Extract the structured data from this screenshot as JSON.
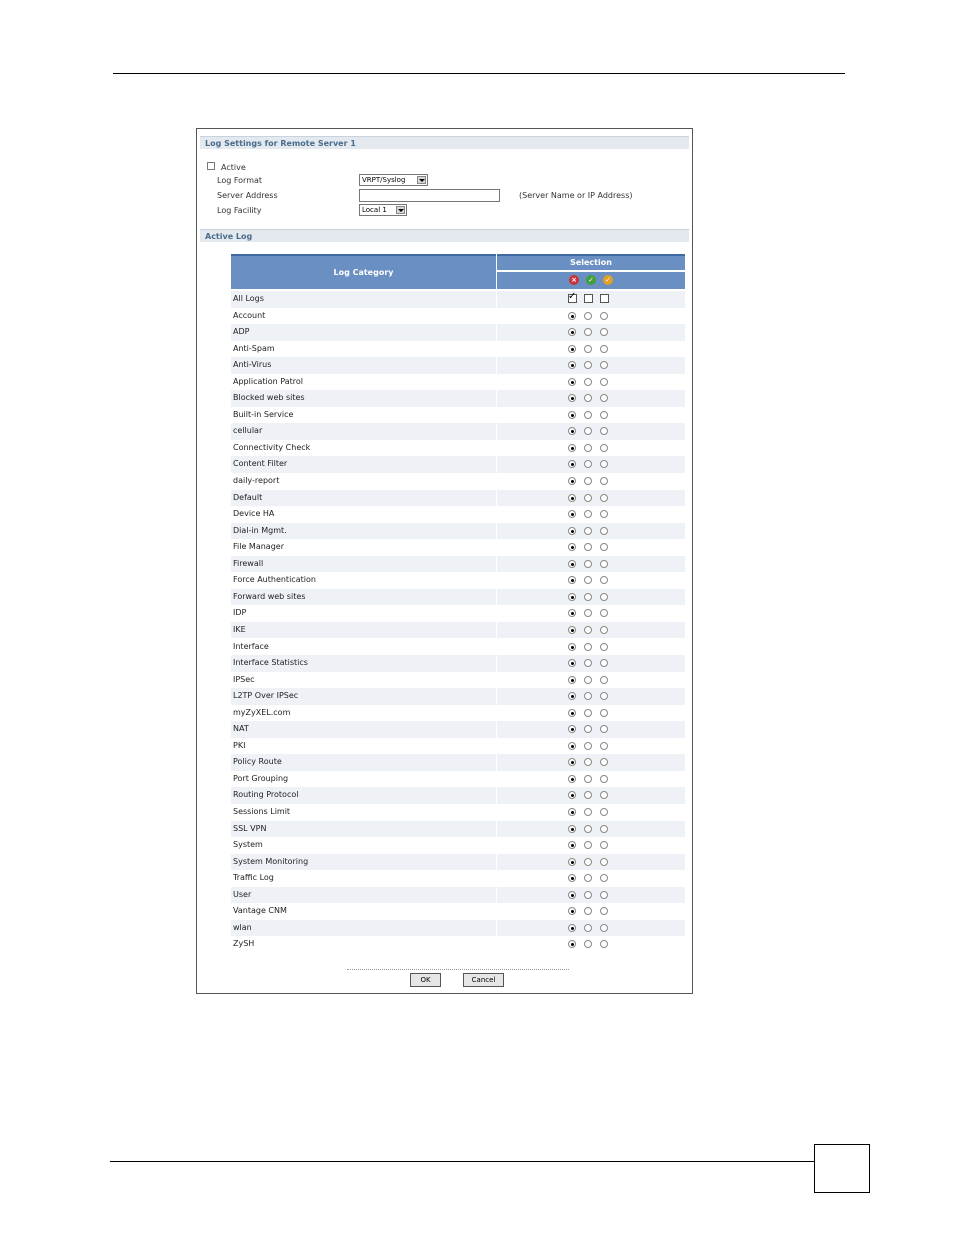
{
  "section1": {
    "title": "Log Settings for Remote Server 1",
    "active_label": "Active",
    "log_format_label": "Log Format",
    "log_format_value": "VRPT/Syslog",
    "server_address_label": "Server Address",
    "server_address_value": "",
    "server_hint": "(Server Name or IP Address)",
    "log_facility_label": "Log Facility",
    "log_facility_value": "Local 1"
  },
  "section2": {
    "title": "Active Log",
    "col_category": "Log Category",
    "col_selection": "Selection",
    "selection_icons": [
      "disable-icon",
      "enable-normal-icon",
      "enable-alert-icon"
    ]
  },
  "all_logs_label": "All Logs",
  "categories": [
    "Account",
    "ADP",
    "Anti-Spam",
    "Anti-Virus",
    "Application Patrol",
    "Blocked web sites",
    "Built-in Service",
    "cellular",
    "Connectivity Check",
    "Content Filter",
    "daily-report",
    "Default",
    "Device HA",
    "Dial-in Mgmt.",
    "File Manager",
    "Firewall",
    "Force Authentication",
    "Forward web sites",
    "IDP",
    "IKE",
    "Interface",
    "Interface Statistics",
    "IPSec",
    "L2TP Over IPSec",
    "myZyXEL.com",
    "NAT",
    "PKI",
    "Policy Route",
    "Port Grouping",
    "Routing Protocol",
    "Sessions Limit",
    "SSL VPN",
    "System",
    "System Monitoring",
    "Traffic Log",
    "User",
    "Vantage CNM",
    "wlan",
    "ZySH"
  ],
  "buttons": {
    "ok": "OK",
    "cancel": "Cancel"
  }
}
